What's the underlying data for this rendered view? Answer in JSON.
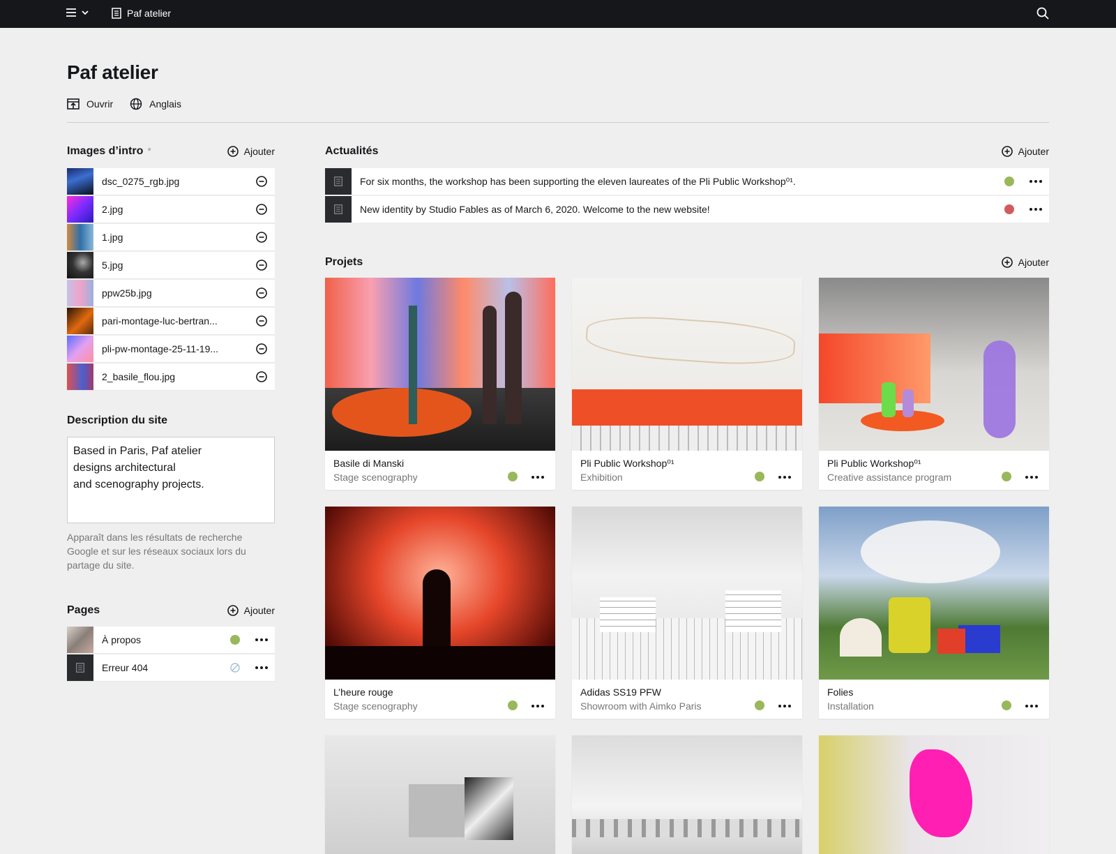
{
  "topbar": {
    "site_name": "Paf atelier",
    "menu_icon": "hamburger-icon",
    "search_icon": "search-icon"
  },
  "page": {
    "title": "Paf atelier",
    "open_label": "Ouvrir",
    "language_label": "Anglais"
  },
  "intro_images": {
    "title": "Images d’intro",
    "required_mark": "*",
    "add_label": "Ajouter",
    "items": [
      {
        "filename": "dsc_0275_rgb.jpg"
      },
      {
        "filename": "2.jpg"
      },
      {
        "filename": "1.jpg"
      },
      {
        "filename": "5.jpg"
      },
      {
        "filename": "ppw25b.jpg"
      },
      {
        "filename": "pari-montage-luc-bertran..."
      },
      {
        "filename": "pli-pw-montage-25-11-19..."
      },
      {
        "filename": "2_basile_flou.jpg"
      }
    ]
  },
  "description": {
    "title": "Description du site",
    "value": "Based in Paris, Paf atelier\ndesigns architectural\nand scenography projects.",
    "help": "Apparaît dans les résultats de recherche Google et sur les réseaux sociaux lors du partage du site."
  },
  "pages": {
    "title": "Pages",
    "add_label": "Ajouter",
    "items": [
      {
        "label": "À propos",
        "status": "published"
      },
      {
        "label": "Erreur 404",
        "status": "draft"
      }
    ]
  },
  "news": {
    "title": "Actualités",
    "add_label": "Ajouter",
    "items": [
      {
        "text": "For six months, the workshop has been supporting the eleven laureates of the Pli Public Workshop⁰¹.",
        "status": "published"
      },
      {
        "text": "New identity by Studio Fables as of March 6, 2020. Welcome to the new website!",
        "status": "draft"
      }
    ]
  },
  "projects": {
    "title": "Projets",
    "add_label": "Ajouter",
    "items": [
      {
        "title": "Basile di Manski",
        "subtitle": "Stage scenography"
      },
      {
        "title": "Pli Public Workshop⁰¹",
        "subtitle": "Exhibition"
      },
      {
        "title": "Pli Public Workshop⁰¹",
        "subtitle": "Creative assistance program"
      },
      {
        "title": "L’heure rouge",
        "subtitle": "Stage scenography"
      },
      {
        "title": "Adidas SS19 PFW",
        "subtitle": "Showroom with Aimko Paris"
      },
      {
        "title": "Folies",
        "subtitle": "Installation"
      }
    ]
  },
  "colors": {
    "published": "#99b85b",
    "draft": "#d45b5b",
    "unlisted": "#a7bfd9",
    "topbar": "#16171a"
  }
}
